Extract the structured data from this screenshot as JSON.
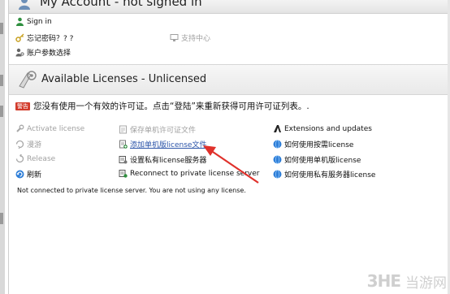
{
  "account": {
    "title": "My Account - not signed in",
    "sign_in": "Sign in",
    "forgot_password": "忘记密码？? ?",
    "support_center": "支持中心",
    "account_params": "账户参数选择"
  },
  "licenses": {
    "title": "Available Licenses - Unlicensed",
    "warning_badge": "警告",
    "warning_text": "您没有使用一个有效的许可证。点击“登陆”来重新获得可用许可证列表。.",
    "col1": {
      "activate": "Activate license",
      "roam": "漫游",
      "release": "Release",
      "refresh": "刷新"
    },
    "col2": {
      "save_file": "保存单机许可证文件",
      "add_file": "添加单机版license文件",
      "set_server": "设置私有license服务器",
      "reconnect": "Reconnect to private license server"
    },
    "col3": {
      "extensions": "Extensions and updates",
      "how_borrow": "如何使用按需license",
      "how_standalone": "如何使用单机版license",
      "how_private": "如何使用私有服务器license"
    },
    "status": "Not connected to private license server. You are not using any license."
  },
  "watermark": {
    "logo": "3HE",
    "text": "当游网"
  },
  "colors": {
    "warning_red": "#d23b2b",
    "link_blue": "#2a53a8",
    "arrow_red": "#e0312b",
    "globe_blue": "#2f7fd8"
  }
}
